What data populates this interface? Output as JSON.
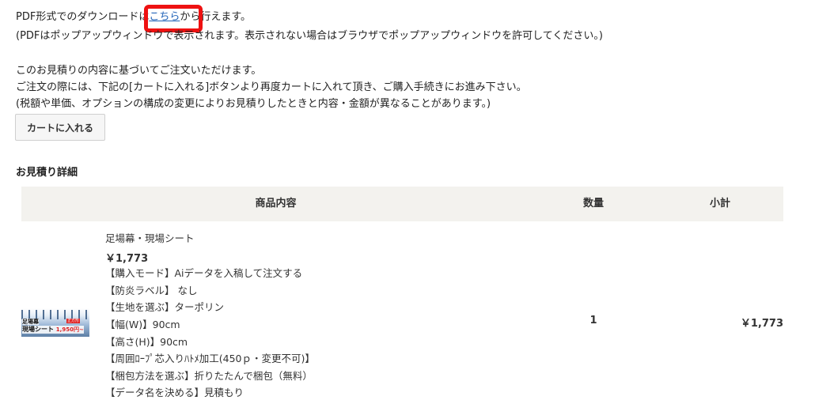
{
  "intro": {
    "pdf_prefix": "PDF形式でのダウンロードは",
    "pdf_link": "こちら",
    "pdf_suffix": "から行えます。",
    "popup_note": "(PDFはポップアップウィンドウで表示されます。表示されない場合はブラウザでポップアップウィンドウを許可してください。)",
    "order_line1": "このお見積りの内容に基づいてご注文いただけます。",
    "order_line2": "ご注文の際には、下記の[カートに入れる]ボタンより再度カートに入れて頂き、ご購入手続きにお進み下さい。",
    "order_line3": "(税額や単価、オプションの構成の変更によりお見積りしたときと内容・金額が異なることがあります。)"
  },
  "cart_button": "カートに入れる",
  "details_title": "お見積り詳細",
  "table": {
    "headers": {
      "product": "商品内容",
      "quantity": "数量",
      "subtotal": "小計"
    },
    "rows": [
      {
        "thumbnail": {
          "line1": "足場幕",
          "line2": "現場シート",
          "price": "1,950円~",
          "badge": "正方形"
        },
        "name": "足場幕・現場シート",
        "price": "￥1,773",
        "options": [
          "【購入モード】Aiデータを入稿して注文する",
          "【防炎ラベル】 なし",
          "【生地を選ぶ】ターポリン",
          "【幅(W)】90cm",
          "【高さ(H)】90cm",
          "【周囲ﾛｰﾌﾟ芯入りﾊﾄﾒ加工(450ｐ・変更不可)】",
          "【梱包方法を選ぶ】折りたたんで梱包（無料）",
          "【データ名を決める】見積もり"
        ],
        "quantity": "1",
        "subtotal": "￥1,773"
      }
    ]
  },
  "colors": {
    "link": "#1f62b8",
    "highlight": "#ee1111",
    "header_bg": "#f3f2ee"
  }
}
